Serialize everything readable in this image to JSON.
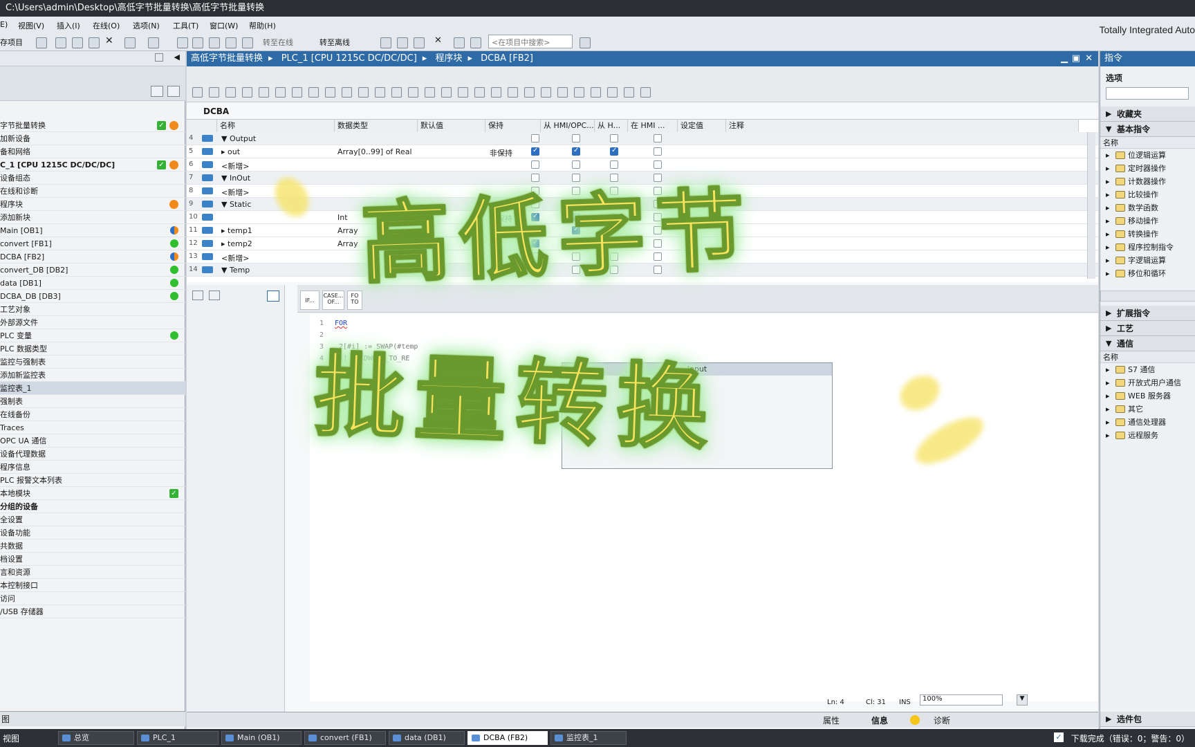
{
  "window": {
    "title": "C:\\Users\\admin\\Desktop\\高低字节批量转换\\高低字节批量转换",
    "brand": "Totally Integrated Auto"
  },
  "menu": [
    "E)",
    "视图(V)",
    "插入(I)",
    "在线(O)",
    "选项(N)",
    "工具(T)",
    "窗口(W)",
    "帮助(H)"
  ],
  "toolbar": {
    "save_project": "存项目",
    "go_online": "转至在线",
    "go_offline": "转至离线",
    "search_placeholder": "<在项目中搜索>"
  },
  "breadcrumb": [
    "高低字节批量转换",
    "PLC_1 [CPU 1215C DC/DC/DC]",
    "程序块",
    "DCBA [FB2]"
  ],
  "block_name": "DCBA",
  "tree": [
    {
      "label": "字节批量转换",
      "bold": false,
      "status": "ok-warn"
    },
    {
      "label": "加新设备",
      "status": ""
    },
    {
      "label": "备和网络",
      "status": ""
    },
    {
      "label": "C_1 [CPU 1215C DC/DC/DC]",
      "bold": true,
      "status": "ok-warn"
    },
    {
      "label": "设备组态",
      "status": ""
    },
    {
      "label": "在线和诊断",
      "status": ""
    },
    {
      "label": "程序块",
      "status": "warn"
    },
    {
      "label": "添加新块",
      "status": ""
    },
    {
      "label": "Main [OB1]",
      "status": "half"
    },
    {
      "label": "convert [FB1]",
      "status": "green"
    },
    {
      "label": "DCBA [FB2]",
      "status": "half"
    },
    {
      "label": "convert_DB [DB2]",
      "status": "green"
    },
    {
      "label": "data [DB1]",
      "status": "green"
    },
    {
      "label": "DCBA_DB [DB3]",
      "status": "green"
    },
    {
      "label": "工艺对象",
      "status": ""
    },
    {
      "label": "外部源文件",
      "status": ""
    },
    {
      "label": "PLC 变量",
      "status": "green"
    },
    {
      "label": "PLC 数据类型",
      "status": ""
    },
    {
      "label": "监控与强制表",
      "status": ""
    },
    {
      "label": "添加新监控表",
      "status": ""
    },
    {
      "label": "监控表_1",
      "status": "",
      "selected": true
    },
    {
      "label": "强制表",
      "status": ""
    },
    {
      "label": "在线备份",
      "status": ""
    },
    {
      "label": "Traces",
      "status": ""
    },
    {
      "label": "OPC UA 通信",
      "status": ""
    },
    {
      "label": "设备代理数据",
      "status": ""
    },
    {
      "label": "程序信息",
      "status": ""
    },
    {
      "label": "PLC 报警文本列表",
      "status": ""
    },
    {
      "label": "本地模块",
      "status": "ok"
    },
    {
      "label": "分组的设备",
      "bold": true,
      "status": ""
    },
    {
      "label": "全设置",
      "status": ""
    },
    {
      "label": "设备功能",
      "status": ""
    },
    {
      "label": "共数据",
      "status": ""
    },
    {
      "label": "档设置",
      "status": ""
    },
    {
      "label": "言和资源",
      "status": ""
    },
    {
      "label": "本控制接口",
      "status": ""
    },
    {
      "label": "访问",
      "status": ""
    },
    {
      "label": "/USB 存储器",
      "status": ""
    }
  ],
  "left_footer": "图",
  "grid": {
    "headers": [
      "名称",
      "数据类型",
      "默认值",
      "保持",
      "从 HMI/OPC...",
      "从 H...",
      "在 HMI ...",
      "设定值",
      "注释"
    ],
    "rows": [
      {
        "num": "4",
        "name": "▼ Output",
        "type": "",
        "retain": "",
        "cb": [
          0,
          0,
          0,
          0
        ],
        "alt": true
      },
      {
        "num": "5",
        "name": "  ▸ out",
        "type": "Array[0..99] of Real",
        "retain": "非保持",
        "cb": [
          1,
          1,
          1,
          0
        ]
      },
      {
        "num": "6",
        "name": "      <新增>",
        "type": "",
        "retain": "",
        "cb": [
          0,
          0,
          0,
          0
        ]
      },
      {
        "num": "7",
        "name": "▼ InOut",
        "type": "",
        "retain": "",
        "cb": [
          0,
          0,
          0,
          0
        ],
        "alt": true
      },
      {
        "num": "8",
        "name": "      <新增>",
        "type": "",
        "retain": "",
        "cb": [
          0,
          0,
          0,
          0
        ]
      },
      {
        "num": "9",
        "name": "▼ Static",
        "type": "",
        "retain": "",
        "cb": [
          0,
          0,
          0,
          0
        ],
        "alt": true
      },
      {
        "num": "10",
        "name": "",
        "type": "Int",
        "retain": "非保持",
        "cb": [
          1,
          1,
          1,
          0
        ]
      },
      {
        "num": "11",
        "name": "  ▸ temp1",
        "type": "Array",
        "retain": "非",
        "cb": [
          1,
          1,
          0,
          0
        ]
      },
      {
        "num": "12",
        "name": "  ▸ temp2",
        "type": "Array",
        "retain": "",
        "cb": [
          1,
          1,
          0,
          0
        ]
      },
      {
        "num": "13",
        "name": "      <新增>",
        "type": "",
        "retain": "",
        "cb": [
          0,
          0,
          0,
          0
        ]
      },
      {
        "num": "14",
        "name": "▼ Temp",
        "type": "",
        "retain": "",
        "cb": [
          0,
          0,
          0,
          0
        ],
        "alt": true
      }
    ]
  },
  "code_tabs": [
    "IF...",
    "CASE... OF...",
    "FO TO"
  ],
  "code_lines": [
    {
      "n": "1",
      "t": "FOR"
    },
    {
      "n": "2",
      "t": ""
    },
    {
      "n": "3",
      "t": "      2[#i] := SWAP(#temp"
    },
    {
      "n": "4",
      "t": "     i] := DWORD_TO_RE"
    }
  ],
  "popup_title": "Input",
  "status": {
    "ln": "Ln: 4",
    "cl": "Cl: 31",
    "ins": "INS",
    "zoom": "100%"
  },
  "props_tabs": [
    "属性",
    "信息",
    "诊断"
  ],
  "right": {
    "title": "指令",
    "options": "选项",
    "sections": {
      "fav": "收藏夹",
      "basic": "基本指令",
      "ext": "扩展指令",
      "tech": "工艺",
      "comm": "通信",
      "pkg": "选件包"
    },
    "col": "名称",
    "basic_items": [
      "位逻辑运算",
      "定时器操作",
      "计数器操作",
      "比较操作",
      "数学函数",
      "移动操作",
      "转换操作",
      "程序控制指令",
      "字逻辑运算",
      "移位和循环"
    ],
    "comm_items": [
      "S7 通信",
      "开放式用户通信",
      "WEB 服务器",
      "其它",
      "通信处理器",
      "远程服务"
    ]
  },
  "taskbar": {
    "portal": "视图",
    "tasks": [
      "总览",
      "PLC_1",
      "Main (OB1)",
      "convert (FB1)",
      "data (DB1)",
      "DCBA (FB2)",
      "监控表_1"
    ],
    "active": "DCBA (FB2)",
    "status": "下载完成（错误：0；警告：0）"
  },
  "overlay": {
    "line1": "高低字节",
    "line2": "批量转换"
  },
  "colors": {
    "accent": "#2d6aa6",
    "overlay_fill": "#f7e35c",
    "overlay_glow": "#a8ecb0"
  }
}
